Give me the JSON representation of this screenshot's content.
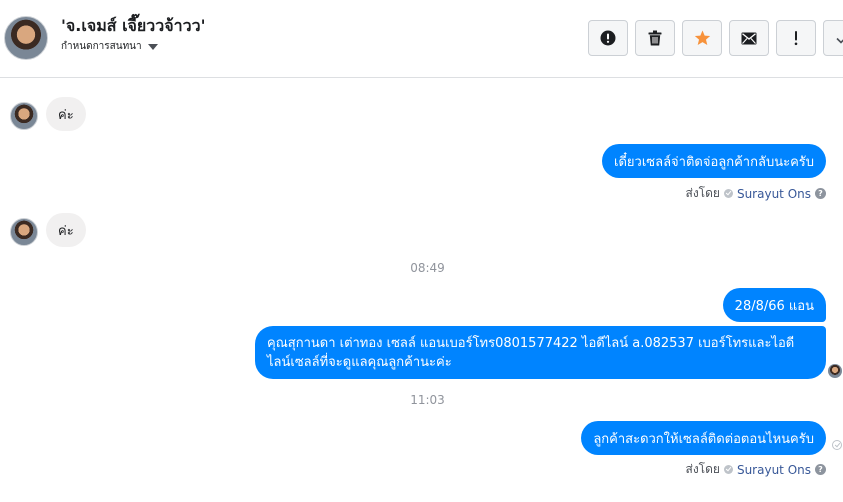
{
  "header": {
    "contact_name": "'จ.เจมส์ เจี๊ยววจ้าวว'",
    "manage_label": "กำหนดการสนทนา",
    "toolbar": [
      {
        "name": "mark-spam-button",
        "icon": "exclamation-circle-icon"
      },
      {
        "name": "delete-button",
        "icon": "trash-icon"
      },
      {
        "name": "star-button",
        "icon": "star-icon",
        "color": "#f7923b"
      },
      {
        "name": "mark-unread-button",
        "icon": "envelope-icon"
      },
      {
        "name": "follow-up-button",
        "icon": "exclamation-icon"
      },
      {
        "name": "mark-done-button",
        "icon": "check-icon"
      }
    ]
  },
  "messages": [
    {
      "direction": "in",
      "text": "ค่ะ"
    },
    {
      "direction": "out",
      "text": "เดี๋ยวเซลล์จ่าติดจ่อลูกค้ากลับนะครับ"
    },
    {
      "sent_by": {
        "label": "ส่งโดย",
        "name": "Surayut Ons",
        "help": "?"
      }
    },
    {
      "direction": "in",
      "text": "ค่ะ"
    },
    {
      "timestamp": "08:49"
    },
    {
      "direction": "out",
      "text": "28/8/66 แอน"
    },
    {
      "direction": "out",
      "line1": "คุณสุกานดา เต่าทอง  เซลล์ แอนเบอร์โทร0801577422 ไอดีไลน์ a.082537  เบอร์โทรและไอดี",
      "line2": "ไลน์เซลล์ที่จะดูแลคุณลูกค้านะค่ะ"
    },
    {
      "timestamp": "11:03"
    },
    {
      "direction": "out",
      "text": "ลูกค้าสะดวกให้เซลล์ติดต่อตอนไหนครับ"
    },
    {
      "sent_by": {
        "label": "ส่งโดย",
        "name": "Surayut Ons",
        "help": "?"
      }
    }
  ],
  "colors": {
    "outgoing": "#0084ff",
    "incoming": "#f1f0f0",
    "accent_star": "#f7923b"
  }
}
